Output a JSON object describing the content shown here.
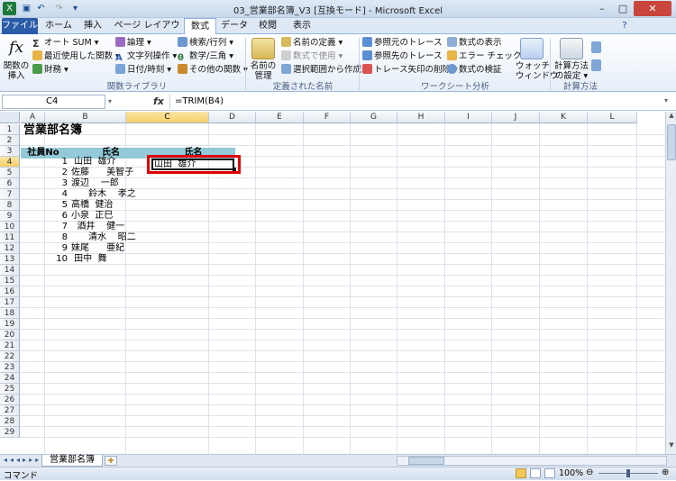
{
  "window": {
    "title": "03_営業部名簿_V3 [互換モード] - Microsoft Excel"
  },
  "tabs": [
    "ファイル",
    "ホーム",
    "挿入",
    "ページ レイアウト",
    "数式",
    "データ",
    "校閲",
    "表示"
  ],
  "ribbon": {
    "function_library": {
      "insert_function": "関数の\n挿入",
      "items": [
        "オート SUM ▾",
        "最近使用した関数 ▾",
        "財務 ▾",
        "論理 ▾",
        "文字列操作 ▾",
        "日付/時刻 ▾",
        "検索/行列 ▾",
        "数学/三角 ▾",
        "その他の関数 ▾"
      ],
      "group_label": "関数ライブラリ"
    },
    "defined_names": {
      "name_manager": "名前の\n管理",
      "items": [
        "名前の定義 ▾",
        "数式で使用 ▾",
        "選択範囲から作成"
      ],
      "group_label": "定義された名前"
    },
    "formula_auditing": {
      "items": [
        "参照元のトレース",
        "参照先のトレース",
        "トレース矢印の削除 ▾",
        "数式の表示",
        "エラー チェック ▾",
        "数式の検証"
      ],
      "watch_window": "ウォッチ\nウィンドウ",
      "group_label": "ワークシート分析"
    },
    "calculation": {
      "calc_options": "計算方法\nの設定 ▾",
      "group_label": "計算方法"
    }
  },
  "formula_bar": {
    "name_box": "C4",
    "fx": "fx",
    "formula": "=TRIM(B4)"
  },
  "columns": [
    "A",
    "B",
    "C",
    "D",
    "E",
    "F",
    "G",
    "H",
    "I",
    "J",
    "K",
    "L"
  ],
  "rows": [
    "1",
    "2",
    "3",
    "4",
    "5",
    "6",
    "7",
    "8",
    "9",
    "10",
    "11",
    "12",
    "13",
    "14",
    "15",
    "16",
    "17",
    "18",
    "19",
    "20",
    "21",
    "22",
    "23",
    "24",
    "25",
    "26",
    "27",
    "28",
    "29"
  ],
  "sheet": {
    "title": "営業部名簿",
    "header": {
      "no": "社員No",
      "name": "氏名",
      "trimmed": "氏名"
    },
    "records": [
      {
        "no": "1",
        "name": " 山田  雄介"
      },
      {
        "no": "2",
        "name": "佐藤      美智子"
      },
      {
        "no": "3",
        "name": "渡辺    一郎"
      },
      {
        "no": "4",
        "name": "      鈴木    孝之"
      },
      {
        "no": "5",
        "name": "高橋  健治"
      },
      {
        "no": "6",
        "name": "小泉  正巳"
      },
      {
        "no": "7",
        "name": "  酒井    健一"
      },
      {
        "no": "8",
        "name": "      清水    昭二"
      },
      {
        "no": "9",
        "name": "妹尾      亜紀"
      },
      {
        "no": "10",
        "name": " 田中  舞"
      }
    ],
    "c4_value": "山田  雄介"
  },
  "sheet_tabs": [
    "営業部名簿"
  ],
  "status": {
    "mode": "コマンド",
    "zoom": "100%"
  }
}
